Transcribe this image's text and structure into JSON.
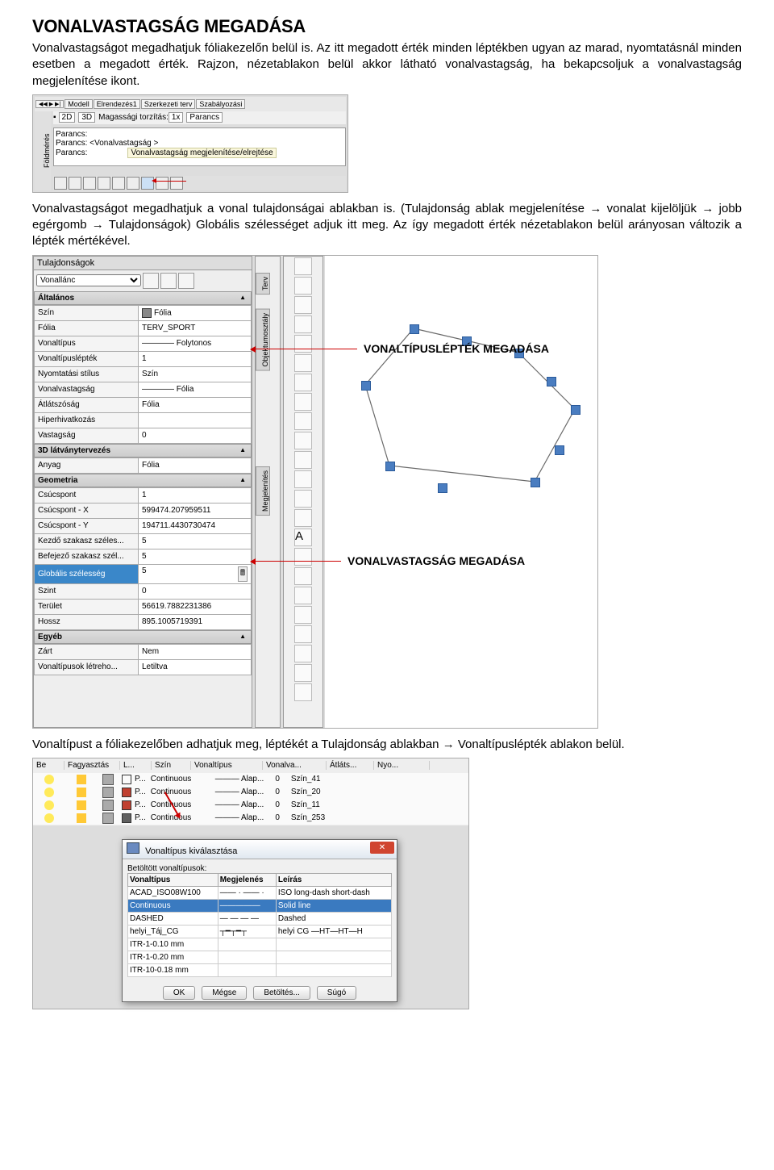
{
  "heading": "VONALVASTAGSÁG MEGADÁSA",
  "para1": "Vonalvastagságot megadhatjuk fóliakezelőn belül is. Az itt megadott érték minden léptékben ugyan az marad, nyomtatásnál minden esetben a megadott érték. Rajzon, nézetablakon belül akkor látható vonalvastagság, ha bekapcsoljuk a vonalvastagság megjelenítése ikont.",
  "para2": "Vonalvastagságot megadhatjuk a vonal tulajdonságai ablakban is. (Tulajdonság ablak megjelenítése → vonalat kijelöljük → jobb egérgomb → Tulajdonságok) Globális szélességet adjuk itt meg. Az így megadott érték nézetablakon belül arányosan változik a lépték mértékével.",
  "para3": "Vonaltípust a fóliakezelőben adhatjuk meg, léptékét a Tulajdonság ablakban → Vonaltípuslépték ablakon belül.",
  "img1": {
    "tabs": [
      "Modell",
      "Elrendezés1",
      "Szerkezeti terv",
      "Szabályozási"
    ],
    "sb_2d": "2D",
    "sb_3d": "3D",
    "sb_lab": "Magassági torzítás:",
    "sb_1x": "1x",
    "sb_par": "Parancs",
    "cmd1": "Parancs:",
    "cmd2": "Parancs: <Vonalvastagság >",
    "cmd3": "Parancs:",
    "tooltip": "Vonalvastagság megjelenítése/elrejtése",
    "side": "Földmérés"
  },
  "img2": {
    "panel_title": "Tulajdonságok",
    "dropdown": "Vonallánc",
    "canvas_tabs": [
      "Terv",
      "Objektumosztály",
      "Megjelenítés"
    ],
    "sections": {
      "altalanos": "Általános",
      "latvany": "3D látványtervezés",
      "geom": "Geometria",
      "egyeb": "Egyéb"
    },
    "rows": {
      "szin": {
        "k": "Szín",
        "v": "Fólia"
      },
      "folia": {
        "k": "Fólia",
        "v": "TERV_SPORT"
      },
      "vtip": {
        "k": "Vonaltípus",
        "v": "Folytonos"
      },
      "vlep": {
        "k": "Vonaltípuslépték",
        "v": "1"
      },
      "nyst": {
        "k": "Nyomtatási stílus",
        "v": "Szín"
      },
      "vvas": {
        "k": "Vonalvastagság",
        "v": "Fólia"
      },
      "atl": {
        "k": "Átlátszóság",
        "v": "Fólia"
      },
      "hip": {
        "k": "Hiperhivatkozás",
        "v": ""
      },
      "vast": {
        "k": "Vastagság",
        "v": "0"
      },
      "any": {
        "k": "Anyag",
        "v": "Fólia"
      },
      "csp": {
        "k": "Csúcspont",
        "v": "1"
      },
      "cspx": {
        "k": "Csúcspont - X",
        "v": "599474.207959511"
      },
      "cspy": {
        "k": "Csúcspont - Y",
        "v": "194711.4430730474"
      },
      "ksz": {
        "k": "Kezdő szakasz széles...",
        "v": "5"
      },
      "bsz": {
        "k": "Befejező szakasz szél...",
        "v": "5"
      },
      "gsz": {
        "k": "Globális szélesség",
        "v": "5"
      },
      "szt": {
        "k": "Szint",
        "v": "0"
      },
      "ter": {
        "k": "Terület",
        "v": "56619.7882231386"
      },
      "hos": {
        "k": "Hossz",
        "v": "895.1005719391"
      },
      "zar": {
        "k": "Zárt",
        "v": "Nem"
      },
      "vlt": {
        "k": "Vonaltípusok létreho...",
        "v": "Letiltva"
      }
    },
    "annot1": "VONALTÍPUSLÉPTÉK MEGADÁSA",
    "annot2": "VONALVASTAGSÁG MEGADÁSA"
  },
  "img3": {
    "headers": [
      "Be",
      "Fagyasztás",
      "L...",
      "Szín",
      "Vonaltípus",
      "Vonalva...",
      "Átláts...",
      "Nyo..."
    ],
    "rows": [
      {
        "c": "#d0b030",
        "lt": "Continuous",
        "lw": "Alap...",
        "a": "0",
        "n": "Szín_41"
      },
      {
        "c": "#c04030",
        "lt": "Continuous",
        "lw": "Alap...",
        "a": "0",
        "n": "Szín_20"
      },
      {
        "c": "#c04030",
        "lt": "Continuous",
        "lw": "Alap...",
        "a": "0",
        "n": "Szín_11"
      },
      {
        "c": "#606060",
        "lt": "Continuous",
        "lw": "Alap...",
        "a": "0",
        "n": "Szín_253"
      }
    ],
    "dlg": {
      "title": "Vonaltípus kiválasztása",
      "label": "Betöltött vonaltípusok:",
      "cols": [
        "Vonaltípus",
        "Megjelenés",
        "Leírás"
      ],
      "r1": {
        "n": "ACAD_ISO08W100",
        "d": "ISO long-dash short-dash"
      },
      "r2": {
        "n": "Continuous",
        "d": "Solid line"
      },
      "r3": {
        "n": "DASHED",
        "d": "Dashed"
      },
      "r4": {
        "n": "helyi_Táj_CG",
        "d": "helyi CG —HT—HT—H"
      },
      "r5": {
        "n": "ITR-1-0.10 mm",
        "d": ""
      },
      "r6": {
        "n": "ITR-1-0.20 mm",
        "d": ""
      },
      "r7": {
        "n": "ITR-10-0.18 mm",
        "d": ""
      },
      "btns": [
        "OK",
        "Mégse",
        "Betöltés...",
        "Súgó"
      ]
    }
  }
}
